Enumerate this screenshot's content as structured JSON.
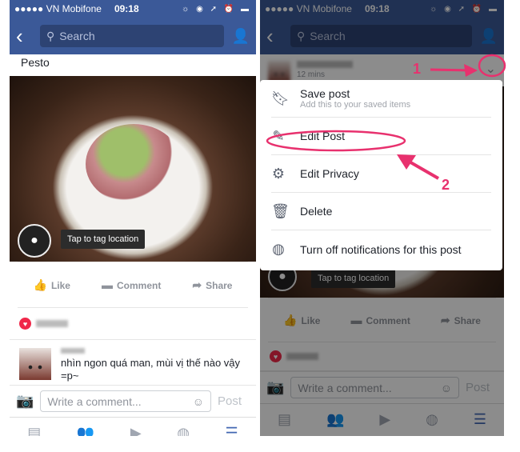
{
  "status": {
    "carrier": "●●●●● VN Mobifone",
    "wifi": "wifi-icon",
    "time": "09:18",
    "right_icons": "☼ ◉ ➚ ⏰ ▬"
  },
  "nav": {
    "back": "‹",
    "search_placeholder": "Search",
    "friends_icon": "friend-requests-icon"
  },
  "post": {
    "caption": "Pesto",
    "time": "12 mins",
    "tag_location": "Tap to tag location"
  },
  "actions": {
    "like": "Like",
    "comment": "Comment",
    "share": "Share"
  },
  "comment": {
    "text": "nhìn ngon quá man, mùi vị thế nào vậy =p~"
  },
  "comment_bar": {
    "placeholder": "Write a comment...",
    "post": "Post"
  },
  "menu": {
    "items": [
      {
        "label": "Save post",
        "sub": "Add this to your saved items",
        "icon": "bookmark-icon"
      },
      {
        "label": "Edit Post",
        "icon": "pencil-icon"
      },
      {
        "label": "Edit Privacy",
        "icon": "gear-icon"
      },
      {
        "label": "Delete",
        "icon": "trash-icon"
      },
      {
        "label": "Turn off notifications for this post",
        "icon": "globe-icon"
      }
    ]
  },
  "annotations": {
    "step1": "1",
    "step2": "2",
    "color": "#e8316e"
  },
  "colors": {
    "brand": "#3b5998"
  }
}
